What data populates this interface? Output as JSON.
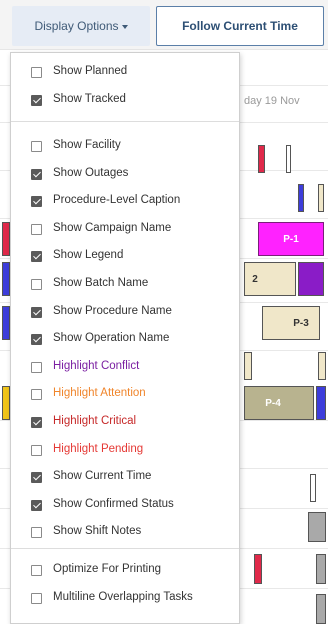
{
  "toolbar": {
    "display_options_label": "Display Options",
    "follow_current_time_label": "Follow Current Time"
  },
  "gantt": {
    "day_label": "day 19 Nov",
    "task_labels": [
      "P-1",
      "2",
      "P-3",
      "P-4"
    ]
  },
  "menu": {
    "groups": [
      [
        {
          "label": "Show Planned",
          "checked": false
        },
        {
          "label": "Show Tracked",
          "checked": true
        }
      ],
      [
        {
          "label": "Show Facility",
          "checked": false
        },
        {
          "label": "Show Outages",
          "checked": true
        },
        {
          "label": "Procedure-Level Caption",
          "checked": true
        },
        {
          "label": "Show Campaign Name",
          "checked": false
        },
        {
          "label": "Show Legend",
          "checked": true
        },
        {
          "label": "Show Batch Name",
          "checked": false
        },
        {
          "label": "Show Procedure Name",
          "checked": true
        },
        {
          "label": "Show Operation Name",
          "checked": true
        },
        {
          "label": "Highlight Conflict",
          "checked": false,
          "color": "#7b1fa2"
        },
        {
          "label": "Highlight Attention",
          "checked": false,
          "color": "#f0852b"
        },
        {
          "label": "Highlight Critical",
          "checked": true,
          "color": "#c62828"
        },
        {
          "label": "Highlight Pending",
          "checked": false,
          "color": "#e53935"
        },
        {
          "label": "Show Current Time",
          "checked": true
        },
        {
          "label": "Show Confirmed Status",
          "checked": true
        },
        {
          "label": "Show Shift Notes",
          "checked": false
        }
      ],
      [
        {
          "label": "Optimize For Printing",
          "checked": false
        },
        {
          "label": "Multiline Overlapping Tasks",
          "checked": false
        }
      ]
    ]
  }
}
